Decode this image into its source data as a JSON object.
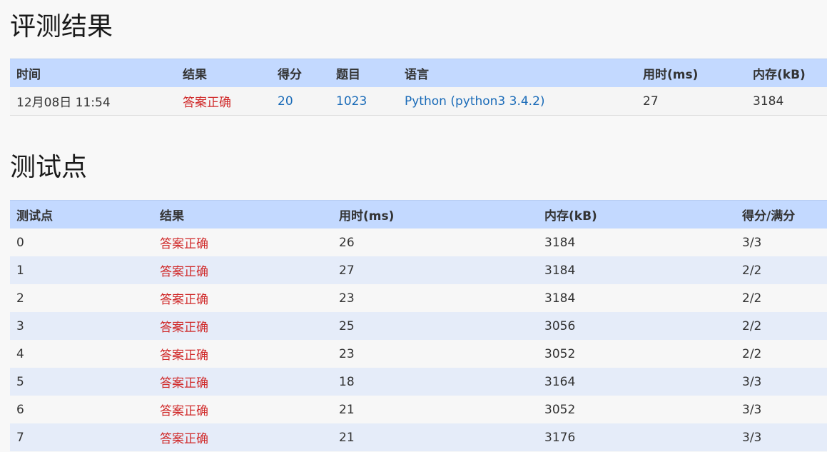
{
  "colors": {
    "header_bg": "#c3d9ff",
    "status_ok": "#d02a2a",
    "link": "#1a6bb8",
    "row_alt": "#e5ecf9"
  },
  "result": {
    "title": "评测结果",
    "headers": [
      "时间",
      "结果",
      "得分",
      "题目",
      "语言",
      "用时(ms)",
      "内存(kB)"
    ],
    "row": {
      "time": "12月08日 11:54",
      "status": "答案正确",
      "score": "20",
      "problem": "1023",
      "language": "Python (python3 3.4.2)",
      "time_ms": "27",
      "memory_kb": "3184"
    }
  },
  "cases": {
    "title": "测试点",
    "headers": [
      "测试点",
      "结果",
      "用时(ms)",
      "内存(kB)",
      "得分/满分"
    ],
    "rows": [
      {
        "id": "0",
        "status": "答案正确",
        "time_ms": "26",
        "memory_kb": "3184",
        "score": "3/3"
      },
      {
        "id": "1",
        "status": "答案正确",
        "time_ms": "27",
        "memory_kb": "3184",
        "score": "2/2"
      },
      {
        "id": "2",
        "status": "答案正确",
        "time_ms": "23",
        "memory_kb": "3184",
        "score": "2/2"
      },
      {
        "id": "3",
        "status": "答案正确",
        "time_ms": "25",
        "memory_kb": "3056",
        "score": "2/2"
      },
      {
        "id": "4",
        "status": "答案正确",
        "time_ms": "23",
        "memory_kb": "3052",
        "score": "2/2"
      },
      {
        "id": "5",
        "status": "答案正确",
        "time_ms": "18",
        "memory_kb": "3164",
        "score": "3/3"
      },
      {
        "id": "6",
        "status": "答案正确",
        "time_ms": "21",
        "memory_kb": "3052",
        "score": "3/3"
      },
      {
        "id": "7",
        "status": "答案正确",
        "time_ms": "21",
        "memory_kb": "3176",
        "score": "3/3"
      }
    ]
  }
}
